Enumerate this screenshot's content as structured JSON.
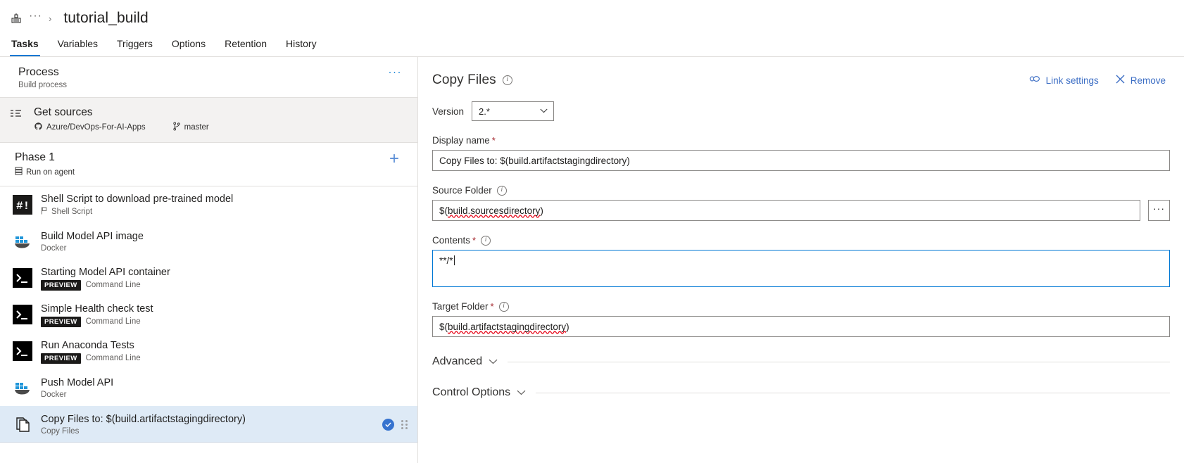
{
  "header": {
    "app_icon": "pipeline-icon",
    "breadcrumb_ellipsis": "···",
    "breadcrumb_separator": "›",
    "title": "tutorial_build",
    "tabs": [
      {
        "label": "Tasks",
        "active": true
      },
      {
        "label": "Variables",
        "active": false
      },
      {
        "label": "Triggers",
        "active": false
      },
      {
        "label": "Options",
        "active": false
      },
      {
        "label": "Retention",
        "active": false
      },
      {
        "label": "History",
        "active": false
      }
    ]
  },
  "sidebar": {
    "process": {
      "title": "Process",
      "subtitle": "Build process",
      "menu_label": "···"
    },
    "get_sources": {
      "title": "Get sources",
      "repository": "Azure/DevOps-For-AI-Apps",
      "branch": "master"
    },
    "phase": {
      "title": "Phase 1",
      "subtitle": "Run on agent",
      "add_label": "+"
    },
    "tasks": [
      {
        "name": "Shell Script to download pre-trained model",
        "type": "Shell Script",
        "icon": "shell-script-icon",
        "preview": false,
        "selected": false
      },
      {
        "name": "Build Model API image",
        "type": "Docker",
        "icon": "docker-icon",
        "preview": false,
        "selected": false
      },
      {
        "name": "Starting Model API container",
        "type": "Command Line",
        "icon": "command-line-icon",
        "preview": true,
        "preview_label": "PREVIEW",
        "selected": false
      },
      {
        "name": "Simple Health check test",
        "type": "Command Line",
        "icon": "command-line-icon",
        "preview": true,
        "preview_label": "PREVIEW",
        "selected": false
      },
      {
        "name": "Run Anaconda Tests",
        "type": "Command Line",
        "icon": "command-line-icon",
        "preview": true,
        "preview_label": "PREVIEW",
        "selected": false
      },
      {
        "name": "Push Model API",
        "type": "Docker",
        "icon": "docker-icon",
        "preview": false,
        "selected": false
      },
      {
        "name": "Copy Files to: $(build.artifactstagingdirectory)",
        "type": "Copy Files",
        "icon": "copy-files-icon",
        "preview": false,
        "selected": true
      }
    ]
  },
  "detail": {
    "title": "Copy Files",
    "link_settings_label": "Link settings",
    "remove_label": "Remove",
    "version": {
      "label": "Version",
      "value": "2.*"
    },
    "display_name": {
      "label": "Display name",
      "required": "*",
      "value": "Copy Files to: $(build.artifactstagingdirectory)"
    },
    "source_folder": {
      "label": "Source Folder",
      "value": "$(build.sourcesdirectory)",
      "browse_label": "···"
    },
    "contents": {
      "label": "Contents",
      "required": "*",
      "value": "**/*"
    },
    "target_folder": {
      "label": "Target Folder",
      "required": "*",
      "value": "$(build.artifactstagingdirectory)"
    },
    "advanced": {
      "label": "Advanced"
    },
    "control_options": {
      "label": "Control Options"
    }
  },
  "colors": {
    "accent": "#0078d4",
    "link": "#3b6dc4",
    "selected_row": "#deeaf6",
    "required": "#a4262c",
    "check_badge": "#3673cf"
  }
}
